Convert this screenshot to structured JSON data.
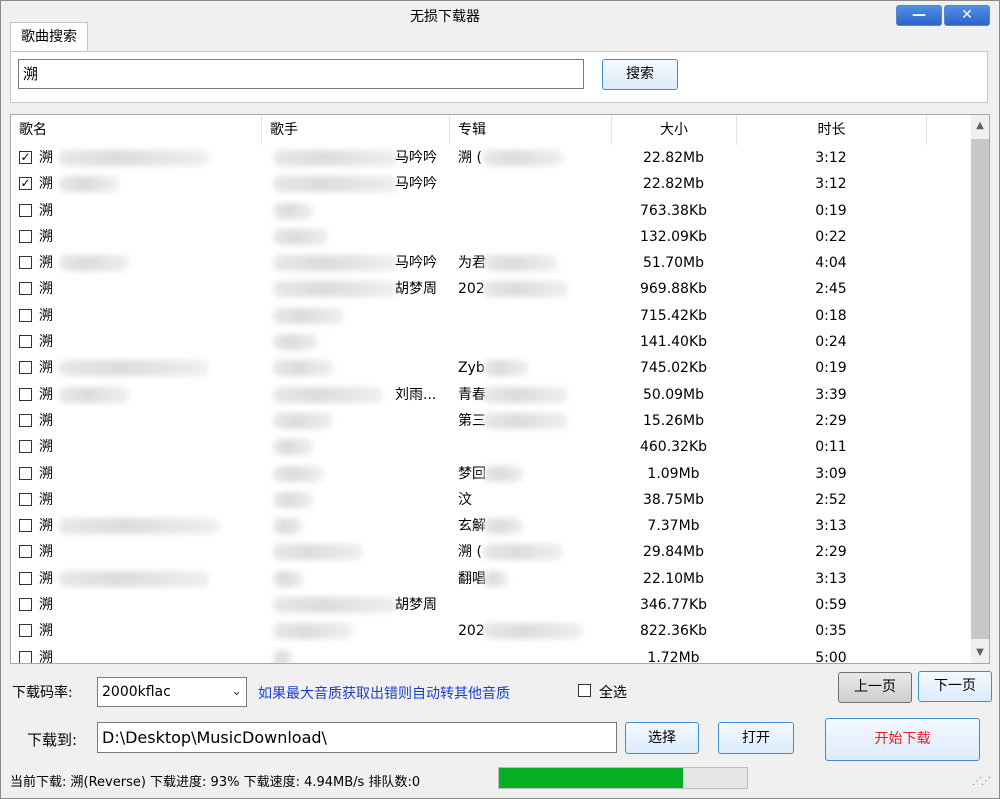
{
  "window": {
    "title": "无损下载器",
    "minimize_label": "—",
    "close_label": "✕"
  },
  "tabs": [
    {
      "label": "歌曲搜索"
    }
  ],
  "search": {
    "value": "溯",
    "button_label": "搜索"
  },
  "table": {
    "columns": [
      "歌名",
      "歌手",
      "专辑",
      "大小",
      "时长"
    ],
    "rows": [
      {
        "checked": true,
        "name": "溯",
        "artist_tail": "马吟吟",
        "album": "溯 (",
        "size": "22.82Mb",
        "duration": "3:12"
      },
      {
        "checked": true,
        "name": "溯",
        "artist_tail": "马吟吟",
        "album": "",
        "size": "22.82Mb",
        "duration": "3:12"
      },
      {
        "checked": false,
        "name": "溯",
        "artist_tail": "",
        "album": "",
        "size": "763.38Kb",
        "duration": "0:19"
      },
      {
        "checked": false,
        "name": "溯",
        "artist_tail": "",
        "album": "",
        "size": "132.09Kb",
        "duration": "0:22"
      },
      {
        "checked": false,
        "name": "溯",
        "artist_tail": "马吟吟",
        "album": "为君",
        "size": "51.70Mb",
        "duration": "4:04"
      },
      {
        "checked": false,
        "name": "溯",
        "artist_tail": "胡梦周",
        "album": "202",
        "size": "969.88Kb",
        "duration": "2:45"
      },
      {
        "checked": false,
        "name": "溯",
        "artist_tail": "",
        "album": "",
        "size": "715.42Kb",
        "duration": "0:18"
      },
      {
        "checked": false,
        "name": "溯",
        "artist_tail": "",
        "album": "",
        "size": "141.40Kb",
        "duration": "0:24"
      },
      {
        "checked": false,
        "name": "溯",
        "artist_tail": "",
        "album": "Zyb",
        "size": "745.02Kb",
        "duration": "0:19"
      },
      {
        "checked": false,
        "name": "溯",
        "artist_tail": "刘雨...",
        "album": "青春",
        "size": "50.09Mb",
        "duration": "3:39"
      },
      {
        "checked": false,
        "name": "溯",
        "artist_tail": "",
        "album": "第三",
        "size": "15.26Mb",
        "duration": "2:29"
      },
      {
        "checked": false,
        "name": "溯",
        "artist_tail": "",
        "album": "",
        "size": "460.32Kb",
        "duration": "0:11"
      },
      {
        "checked": false,
        "name": "溯",
        "artist_tail": "",
        "album": "梦回",
        "size": "1.09Mb",
        "duration": "3:09"
      },
      {
        "checked": false,
        "name": "溯",
        "artist_tail": "",
        "album": "汶",
        "size": "38.75Mb",
        "duration": "2:52"
      },
      {
        "checked": false,
        "name": "溯",
        "artist_tail": "",
        "album": "玄解",
        "size": "7.37Mb",
        "duration": "3:13"
      },
      {
        "checked": false,
        "name": "溯",
        "artist_tail": "",
        "album": "溯 (",
        "size": "29.84Mb",
        "duration": "2:29"
      },
      {
        "checked": false,
        "name": "溯",
        "artist_tail": "",
        "album": "翻唱",
        "size": "22.10Mb",
        "duration": "3:13"
      },
      {
        "checked": false,
        "name": "溯",
        "artist_tail": "胡梦周",
        "album": "",
        "size": "346.77Kb",
        "duration": "0:59"
      },
      {
        "checked": false,
        "name": "溯",
        "artist_tail": "",
        "album": "202",
        "size": "822.36Kb",
        "duration": "0:35"
      },
      {
        "checked": false,
        "name": "溯",
        "artist_tail": "",
        "album": "",
        "size": "1.72Mb",
        "duration": "5:00"
      }
    ]
  },
  "controls": {
    "bitrate_label": "下载码率:",
    "bitrate_value": "2000kflac",
    "hint": "如果最大音质获取出错则自动转其他音质",
    "select_all_label": "全选",
    "prev_label": "上一页",
    "next_label": "下一页",
    "download_to_label": "下载到:",
    "path_value": "D:\\Desktop\\MusicDownload\\",
    "choose_label": "选择",
    "open_label": "打开",
    "start_label": "开始下载"
  },
  "status": {
    "text": "当前下载: 溯(Reverse) 下载进度: 93% 下载速度: 4.94MB/s 排队数:0",
    "progress_fraction": 0.74
  },
  "colors": {
    "accent": "#3c8fd6",
    "start_text": "#e31e1e",
    "hint_text": "#1a3fd1",
    "progress": "#06b025"
  }
}
